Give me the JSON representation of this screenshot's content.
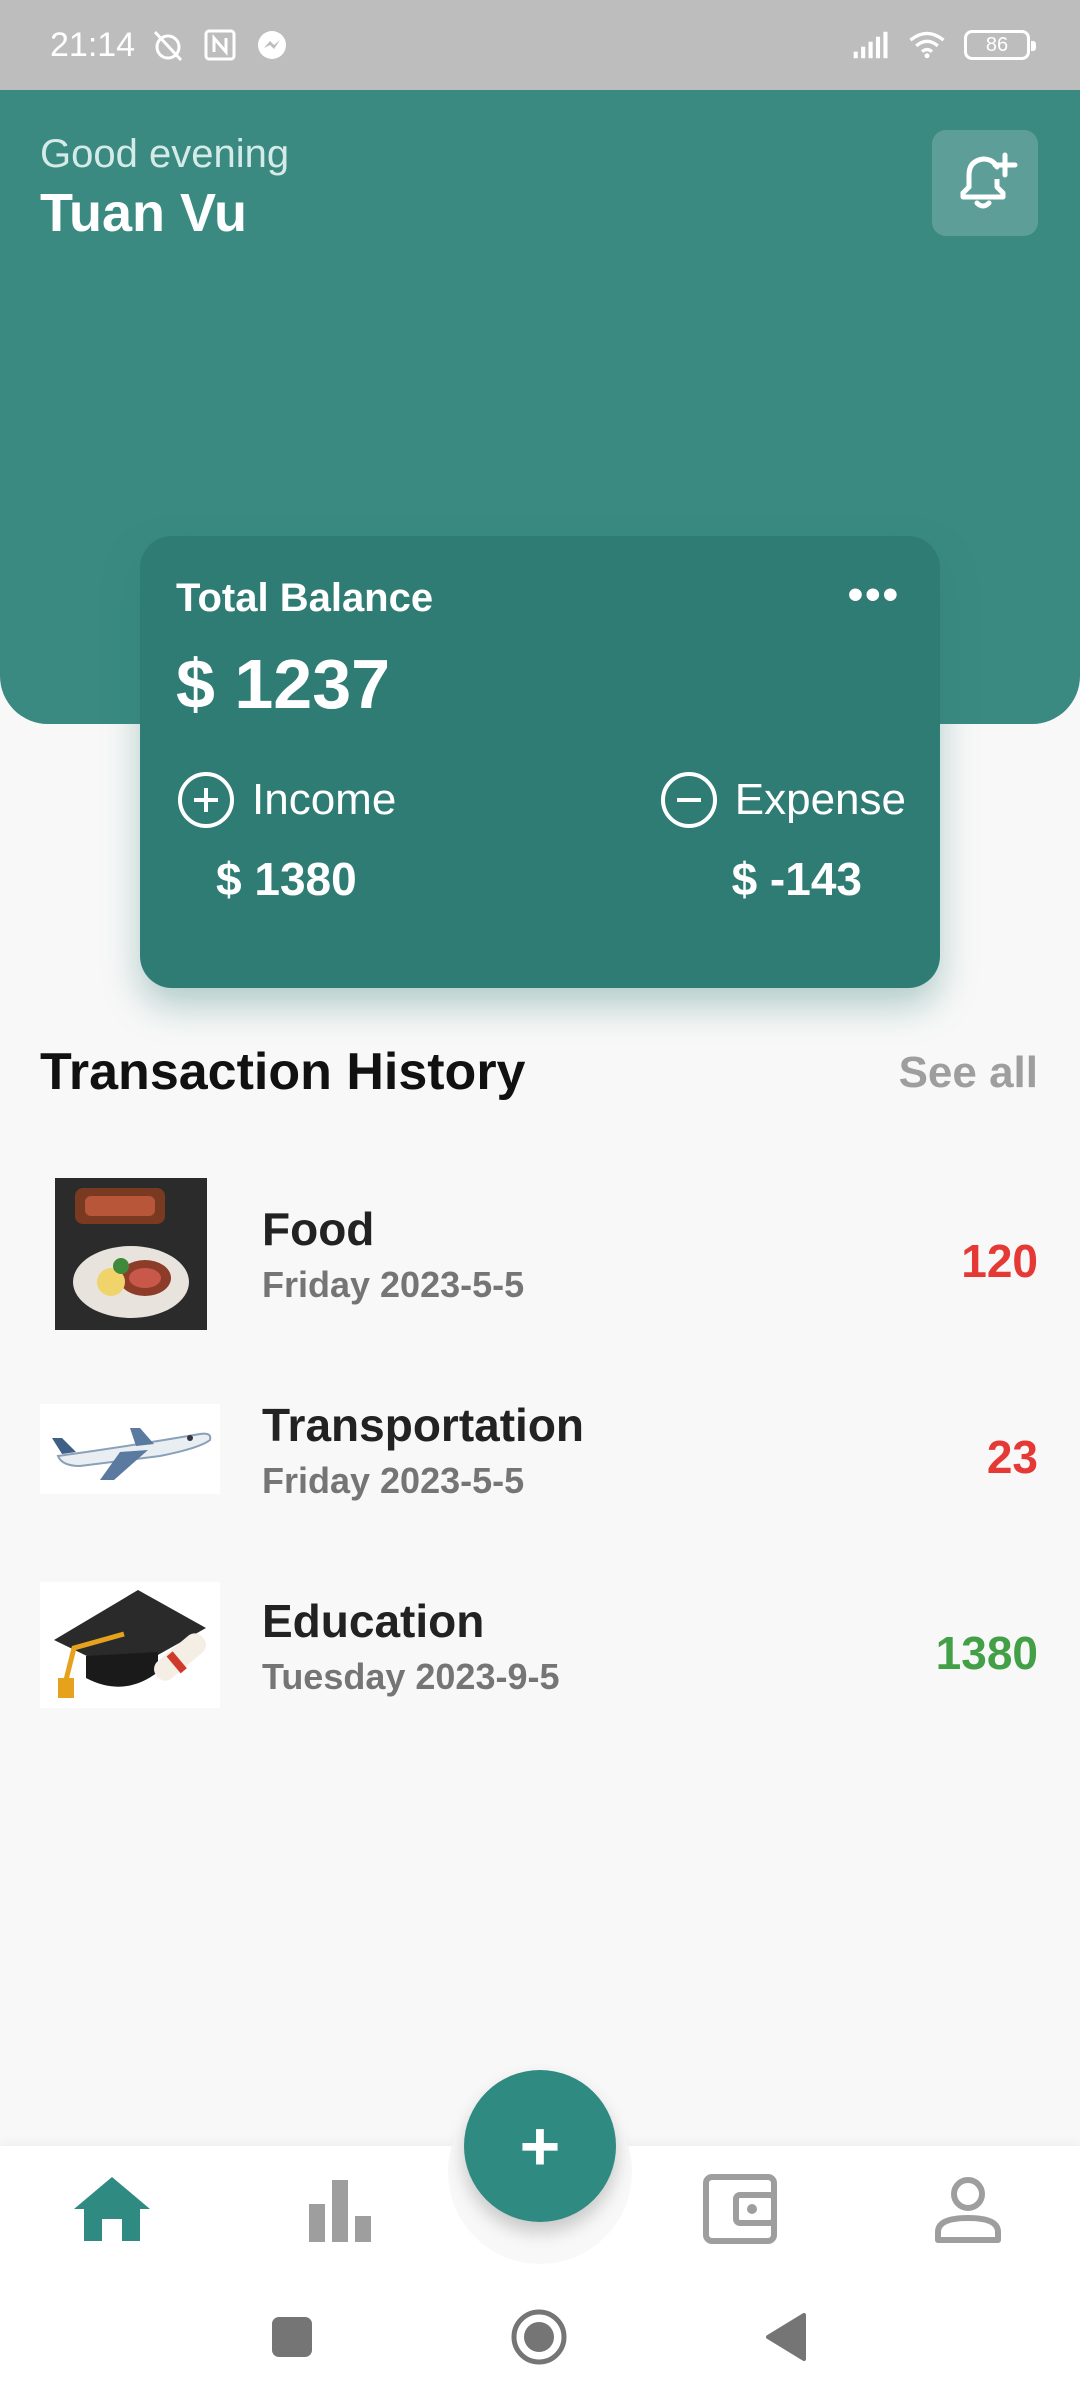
{
  "status_bar": {
    "time": "21:14",
    "battery": "86"
  },
  "header": {
    "greeting": "Good evening",
    "username": "Tuan Vu"
  },
  "balance_card": {
    "title": "Total Balance",
    "more": "•••",
    "total": "$ 1237",
    "income_label": "Income",
    "income_value": "$ 1380",
    "expense_label": "Expense",
    "expense_value": "$ -143"
  },
  "history": {
    "title": "Transaction History",
    "see_all": "See all",
    "items": [
      {
        "name": "Food",
        "date": "Friday  2023-5-5",
        "amount": "120",
        "amount_color": "#e53935"
      },
      {
        "name": "Transportation",
        "date": "Friday  2023-5-5",
        "amount": "23",
        "amount_color": "#e53935"
      },
      {
        "name": "Education",
        "date": "Tuesday  2023-9-5",
        "amount": "1380",
        "amount_color": "#43a047"
      }
    ]
  },
  "bottom_nav": {
    "fab": "+",
    "icons": [
      "home-icon",
      "bar-chart-icon",
      "wallet-icon",
      "person-icon"
    ],
    "active_color": "#2f8a81",
    "inactive_color": "#9e9e9e"
  },
  "colors": {
    "header_bg": "#3a8a82",
    "card_bg": "#2f7c74"
  }
}
